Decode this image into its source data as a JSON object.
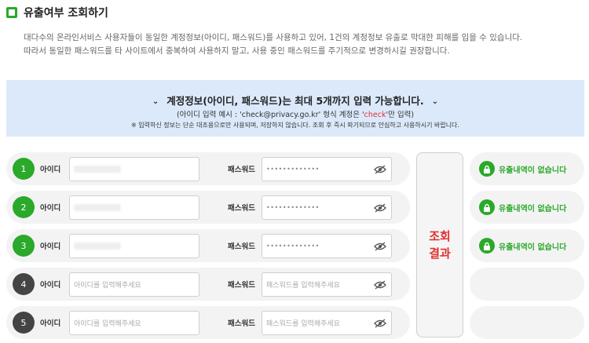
{
  "header": {
    "title": "유출여부 조회하기"
  },
  "description": [
    "대다수의 온라인서비스 사용자들이 동일한 계정정보(아이디, 패스워드)를 사용하고 있어, 1건의 계정정보 유출로 막대한 피해를 입을 수 있습니다.",
    "따라서 동일한 패스워드를 타 사이트에서 중복하여 사용하지 말고, 사용 중인 패스워드를 주기적으로 변경하시길 권장합니다."
  ],
  "banner": {
    "title": "계정정보(아이디, 패스워드)는 최대 5개까지 입력 가능합니다.",
    "example_prefix": "(아이디 입력 예시 : 'check@privacy.go.kr' 형식 계정은 '",
    "example_highlight": "check",
    "example_suffix": "'만 입력)",
    "note": "※ 입력하신 정보는 단순 대조용으로만 사용되며, 저장하지 않습니다. 조회 후 즉시 파기되므로 안심하고 사용하시기 바랍니다.",
    "highlight_color": "#e03030"
  },
  "form": {
    "id_label": "아이디",
    "pw_label": "패스워드",
    "rows": [
      {
        "number": "1",
        "pw_value": "•••••••••••••"
      },
      {
        "number": "2",
        "pw_value": "•••••••••••••"
      },
      {
        "number": "3",
        "pw_value": "•••••••••••••"
      },
      {
        "number": "4",
        "id_placeholder": "아이디를 입력해주세요",
        "pw_placeholder": "패스워드를 입력해주세요"
      },
      {
        "number": "5",
        "id_placeholder": "아이디를 입력해주세요",
        "pw_placeholder": "패스워드를 입력해주세요"
      }
    ]
  },
  "result_button": {
    "line1": "조회",
    "line2": "결과"
  },
  "results": [
    {
      "text": "유출내역이 없습니다"
    },
    {
      "text": "유출내역이 없습니다"
    },
    {
      "text": "유출내역이 없습니다"
    }
  ],
  "colors": {
    "accent": "#2aa92a",
    "dark": "#444444",
    "banner": "#dbe9fb"
  }
}
